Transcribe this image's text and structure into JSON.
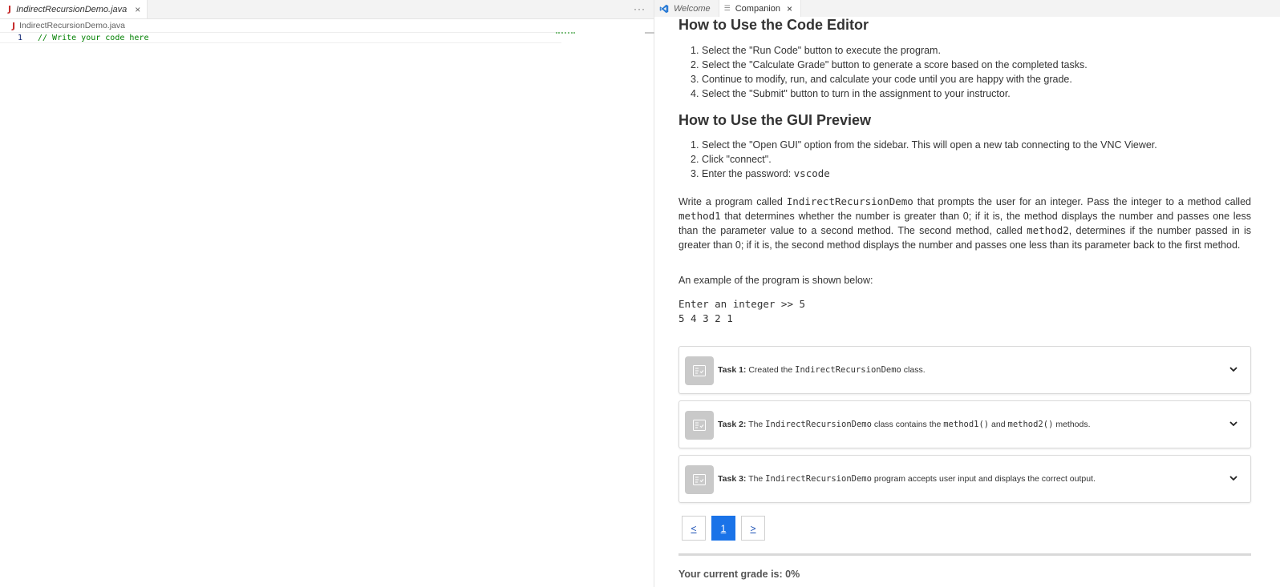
{
  "editor": {
    "tab_title": "IndirectRecursionDemo.java",
    "tab_icon": "java-file-icon",
    "more_label": "···",
    "breadcrumb": "IndirectRecursionDemo.java",
    "lines": [
      {
        "num": "1",
        "text": "// Write your code here"
      }
    ]
  },
  "companion_tabs": [
    {
      "label": "Welcome",
      "icon": "vscode-icon"
    },
    {
      "label": "Companion",
      "icon": "document-icon"
    }
  ],
  "code_editor_section": {
    "heading": "How to Use the Code Editor",
    "steps": [
      {
        "n": "1.",
        "text": "Select the \"Run Code\" button to execute the program."
      },
      {
        "n": "2.",
        "text": "Select the \"Calculate Grade\" button to generate a score based on the completed tasks."
      },
      {
        "n": "3.",
        "text": "Continue to modify, run, and calculate your code until you are happy with the grade."
      },
      {
        "n": "4.",
        "text": "Select the \"Submit\" button to turn in the assignment to your instructor."
      }
    ]
  },
  "gui_section": {
    "heading": "How to Use the GUI Preview",
    "steps": [
      {
        "n": "1.",
        "text": "Select the \"Open GUI\" option from the sidebar. This will open a new tab connecting to the VNC Viewer."
      },
      {
        "n": "2.",
        "text": "Click \"connect\"."
      },
      {
        "n": "3.",
        "text": "Enter the password: ",
        "code": "vscode"
      }
    ]
  },
  "description": {
    "p1": "Write a program called ",
    "c1": "IndirectRecursionDemo",
    "p2": " that prompts the user for an integer. Pass the integer to a method called ",
    "c2": "method1",
    "p3": " that determines whether the number is greater than 0; if it is, the method displays the number and passes one less than the parameter value to a second method. The second method, called ",
    "c3": "method2",
    "p4": ", determines if the number passed in is greater than 0; if it is, the second method displays the number and passes one less than its parameter back to the first method."
  },
  "example": {
    "intro": "An example of the program is shown below:",
    "line1": "Enter an integer >> 5",
    "line2": "5 4 3 2 1"
  },
  "tasks": [
    {
      "label": "Task 1:",
      "t1": " Created the ",
      "c1": "IndirectRecursionDemo",
      "t2": " class.",
      "c2": "",
      "t3": "",
      "c3": "",
      "t4": ""
    },
    {
      "label": "Task 2:",
      "t1": " The ",
      "c1": "IndirectRecursionDemo",
      "t2": " class contains the ",
      "c2": "method1()",
      "t3": " and ",
      "c3": "method2()",
      "t4": " methods."
    },
    {
      "label": "Task 3:",
      "t1": " The ",
      "c1": "IndirectRecursionDemo",
      "t2": " program accepts user input and displays the correct output.",
      "c2": "",
      "t3": "",
      "c3": "",
      "t4": ""
    }
  ],
  "pager": {
    "prev": "<",
    "current": "1",
    "next": ">"
  },
  "grade": "Your current grade is: 0%",
  "colors": {
    "accent": "#1a73e8",
    "comment": "#008000",
    "java": "#c72e2e"
  }
}
